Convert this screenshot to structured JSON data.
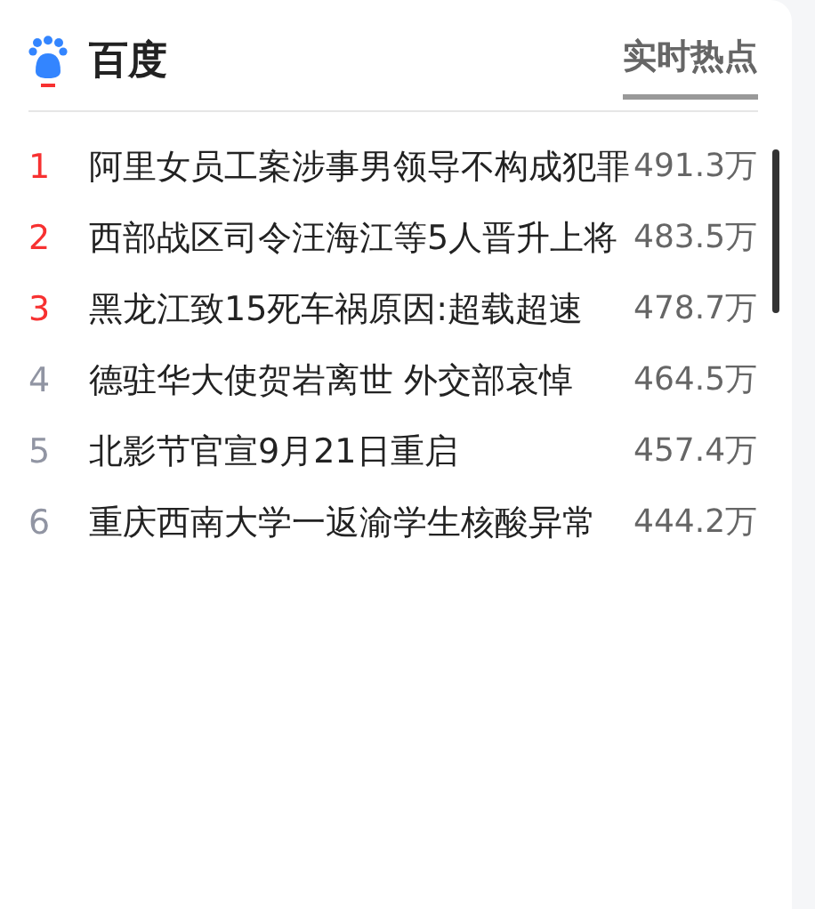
{
  "header": {
    "brand": "百度",
    "tabs": [
      {
        "label": "实时热点",
        "selected": true
      }
    ]
  },
  "hot_list": [
    {
      "rank": "1",
      "title": "阿里女员工案涉事男领导不构成犯罪",
      "heat": "491.3万",
      "top": true
    },
    {
      "rank": "2",
      "title": "西部战区司令汪海江等5人晋升上将",
      "heat": "483.5万",
      "top": true
    },
    {
      "rank": "3",
      "title": "黑龙江致15死车祸原因:超载超速",
      "heat": "478.7万",
      "top": true
    },
    {
      "rank": "4",
      "title": "德驻华大使贺岩离世 外交部哀悼",
      "heat": "464.5万",
      "top": false
    },
    {
      "rank": "5",
      "title": "北影节官宣9月21日重启",
      "heat": "457.4万",
      "top": false
    },
    {
      "rank": "6",
      "title": "重庆西南大学一返渝学生核酸异常",
      "heat": "444.2万",
      "top": false
    }
  ]
}
